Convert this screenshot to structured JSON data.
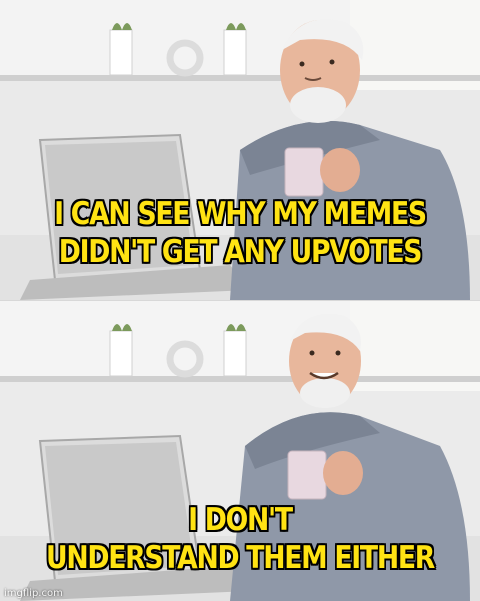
{
  "meme": {
    "top_caption": [
      "I CAN SEE WHY MY MEMES",
      "DIDN'T GET ANY UPVOTES"
    ],
    "bottom_caption": [
      "I DON'T",
      "UNDERSTAND THEM EITHER"
    ],
    "watermark": "imgflip.com",
    "caption_color": "#ffe313",
    "caption_outline_color": "#000000",
    "template": "hide-the-pain-harold",
    "panels": [
      {
        "expression": "looking-at-laptop"
      },
      {
        "expression": "smiling-at-viewer"
      }
    ]
  }
}
